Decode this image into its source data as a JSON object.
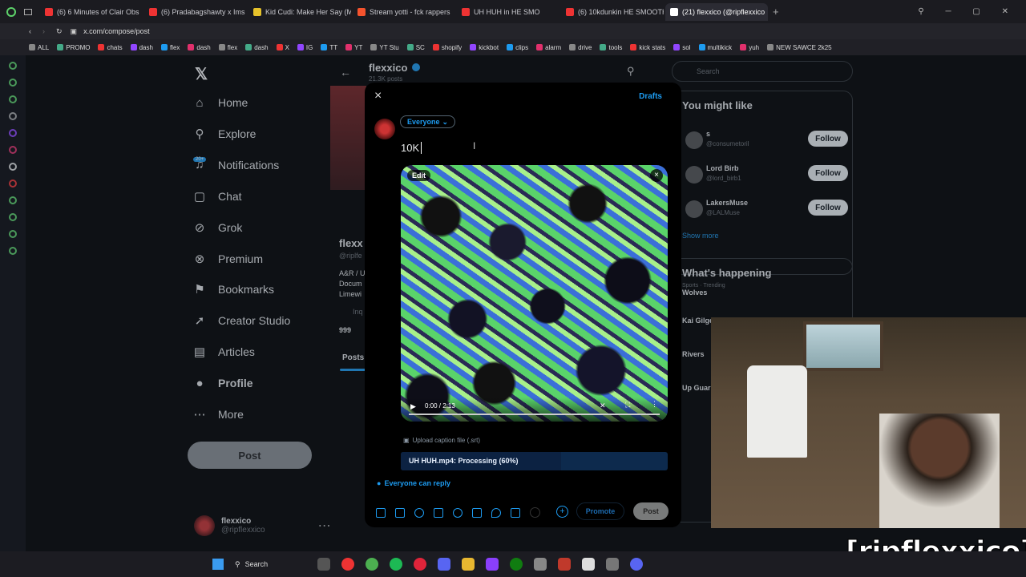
{
  "browser": {
    "tabs": [
      {
        "label": "(6) 6 Minutes of Clair Obs",
        "color": "#e33"
      },
      {
        "label": "(6) Pradabagshawty x Ims",
        "color": "#e33"
      },
      {
        "label": "Kid Cudi: Make Her Say (M",
        "color": "#e6c22b"
      },
      {
        "label": "Stream yotti - fck rappers",
        "color": "#f5532d"
      },
      {
        "label": "UH HUH in HE SMO",
        "color": "#e33"
      },
      {
        "label": "(6) 10kdunkin HE SMOOTH",
        "color": "#e33"
      },
      {
        "label": "(21) flexxico (@ripflexxico",
        "color": "#fff"
      }
    ],
    "url": "x.com/compose/post",
    "bookmarks": [
      "ALL",
      "PROMO",
      "chats",
      "dash",
      "flex",
      "dash",
      "flex",
      "dash",
      "X",
      "IG",
      "TT",
      "YT",
      "YT Stu",
      "SC",
      "shopify",
      "kickbot",
      "clips",
      "alarm",
      "drive",
      "tools",
      "kick stats",
      "sol",
      "multikick",
      "yuh",
      "NEW SAWCE 2k25"
    ]
  },
  "nav": {
    "items": [
      {
        "label": "Home",
        "icon": "home-icon",
        "glyph": "⌂"
      },
      {
        "label": "Explore",
        "icon": "search-icon",
        "glyph": "⚲"
      },
      {
        "label": "Notifications",
        "icon": "bell-icon",
        "glyph": "♫"
      },
      {
        "label": "Chat",
        "icon": "chat-icon",
        "glyph": "▢"
      },
      {
        "label": "Grok",
        "icon": "grok-icon",
        "glyph": "⊘"
      },
      {
        "label": "Premium",
        "icon": "premium-icon",
        "glyph": "⊗"
      },
      {
        "label": "Bookmarks",
        "icon": "bookmark-icon",
        "glyph": "⚑"
      },
      {
        "label": "Creator Studio",
        "icon": "rocket-icon",
        "glyph": "➚"
      },
      {
        "label": "Articles",
        "icon": "articles-icon",
        "glyph": "▤"
      },
      {
        "label": "Profile",
        "icon": "profile-icon",
        "glyph": "●"
      },
      {
        "label": "More",
        "icon": "more-icon",
        "glyph": "⋯"
      }
    ],
    "notif_badge": "20+",
    "post_label": "Post",
    "account_name": "flexxico",
    "account_handle": "@ripflexxico"
  },
  "profile": {
    "name": "flexxico",
    "posts_count": "21.3K posts",
    "display_name": "flexx",
    "handle": "@riplfe",
    "bio1": "A&R / U",
    "bio2": "Docum",
    "bio3": "Limewi",
    "loc": "Inq",
    "followers": "999",
    "tab_posts": "Posts"
  },
  "composer": {
    "close_label": "×",
    "drafts_label": "Drafts",
    "audience_label": "Everyone",
    "text": "10K",
    "edit_label": "Edit",
    "video_time": "0:00 / 2:13",
    "caption_label": "Upload caption file (.srt)",
    "processing": "UH HUH.mp4: Processing (60%)",
    "processing_fraction": 0.6,
    "reply_label": "Everyone can reply",
    "promote_label": "Promote",
    "post_label": "Post"
  },
  "right": {
    "search_placeholder": "Search",
    "might_like": "You might like",
    "suggestions": [
      {
        "name": "s",
        "handle": "@consumetoril"
      },
      {
        "name": "Lord Birb",
        "handle": "@lord_birb1"
      },
      {
        "name": "LakersMuse",
        "handle": "@LALMuse"
      }
    ],
    "follow_label": "Follow",
    "show_more": "Show more",
    "happening": "What's happening",
    "trend_meta": "Sports · Trending",
    "trends": [
      "Wolves",
      "Kai Gilge",
      "Rivers",
      "Up Guar"
    ]
  },
  "overlay_text": "[ripflexxico]",
  "taskbar": {
    "search_label": "Search"
  },
  "colors": {
    "accent": "#1d9bf0",
    "bg": "#000000"
  }
}
